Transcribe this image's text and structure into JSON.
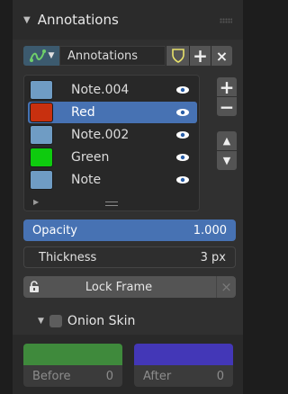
{
  "panel": {
    "title": "Annotations"
  },
  "toolbar": {
    "layer_name": "Annotations",
    "add_label": "+",
    "close_label": "×"
  },
  "layers": [
    {
      "name": "Note.004",
      "color": "#6f9cc4",
      "active": false
    },
    {
      "name": "Red",
      "color": "#c8300f",
      "active": true
    },
    {
      "name": "Note.002",
      "color": "#6f9cc4",
      "active": false
    },
    {
      "name": "Green",
      "color": "#0ecb0e",
      "active": false
    },
    {
      "name": "Note",
      "color": "#6f9cc4",
      "active": false
    }
  ],
  "list_buttons": {
    "add": "+",
    "remove": "−"
  },
  "opacity": {
    "label": "Opacity",
    "value": "1.000"
  },
  "thickness": {
    "label": "Thickness",
    "value": "3 px"
  },
  "lock_frame": {
    "label": "Lock Frame",
    "clear": "×"
  },
  "onion_skin": {
    "label": "Onion Skin",
    "enabled": false,
    "before": {
      "label": "Before",
      "value": "0",
      "color": "#3f8a3c"
    },
    "after": {
      "label": "After",
      "value": "0",
      "color": "#4337b7"
    }
  },
  "colors": {
    "accent": "#4772b3",
    "panel": "#303030",
    "button": "#545454"
  }
}
